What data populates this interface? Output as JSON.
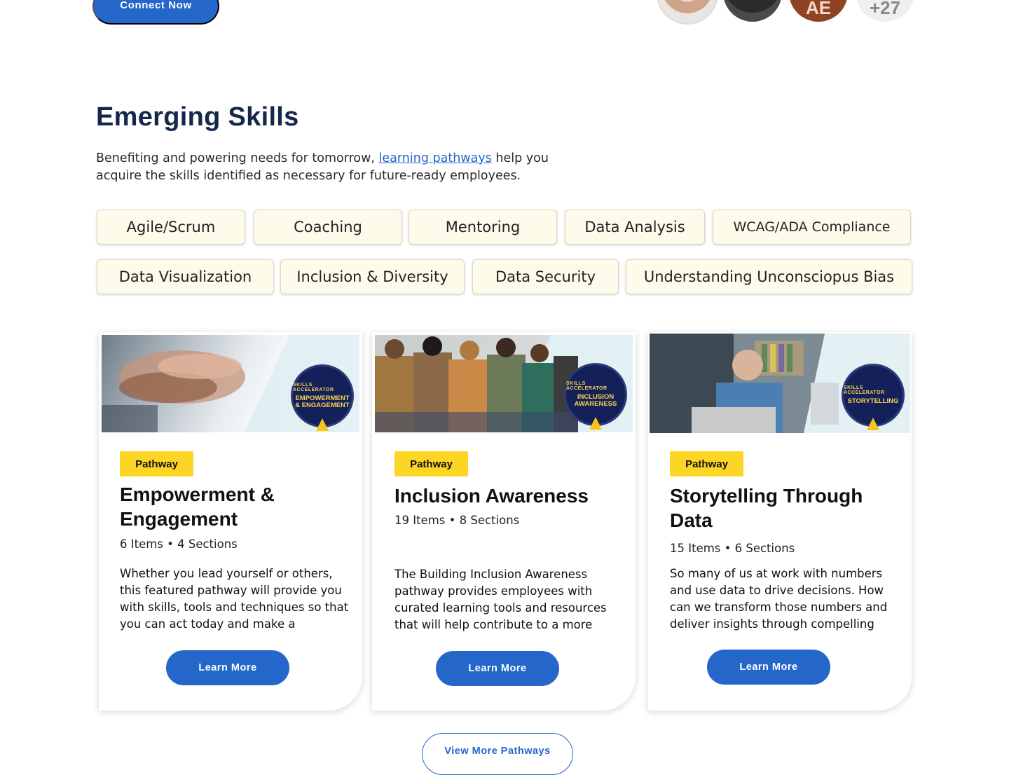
{
  "header": {
    "connect_label": "Connect Now",
    "avatars": [
      {
        "initials": ""
      },
      {
        "initials": ""
      },
      {
        "initials": "AE"
      },
      {
        "initials": "+27"
      }
    ]
  },
  "section": {
    "title": "Emerging Skills",
    "intro_before": "Benefiting and powering  needs for tomorrow, ",
    "intro_link": "learning pathways",
    "intro_after": " help you acquire the skills identified as necessary for future-ready employees."
  },
  "skills": [
    "Agile/Scrum",
    "Coaching",
    "Mentoring",
    "Data Analysis",
    "WCAG/ADA Compliance",
    "Data Visualization",
    "Inclusion & Diversity",
    "Data Security",
    "Understanding Unconsciopus Bias"
  ],
  "cards": [
    {
      "tag": "Pathway",
      "title": "Empowerment & Engagement",
      "meta": "6 Items • 4 Sections",
      "description": "Whether you lead yourself or others, this featured pathway will provide you with skills, tools and techniques so that you can act today and make a difference at Pru.",
      "badge_arc": "SKILLS ACCELERATOR",
      "badge_name": "EMPOWERMENT & ENGAGEMENT",
      "button": "Learn More"
    },
    {
      "tag": "Pathway",
      "title": "Inclusion Awareness",
      "meta": "19 Items • 8 Sections",
      "description": "The Building Inclusion Awareness pathway provides employees with curated learning tools and resources that will help contribute to a more inclusive",
      "badge_arc": "SKILLS ACCELERATOR",
      "badge_name": "INCLUSION AWARENESS",
      "button": "Learn More"
    },
    {
      "tag": "Pathway",
      "title": "Storytelling Through Data",
      "meta": "15 Items • 6 Sections",
      "description": "So many of us at work with numbers and use data to drive decisions. How can we transform those numbers and deliver insights through compelling",
      "badge_arc": "SKILLS ACCELERATOR",
      "badge_name": "STORYTELLING",
      "button": "Learn More"
    }
  ],
  "footer": {
    "view_more_label": "View More Pathways"
  }
}
